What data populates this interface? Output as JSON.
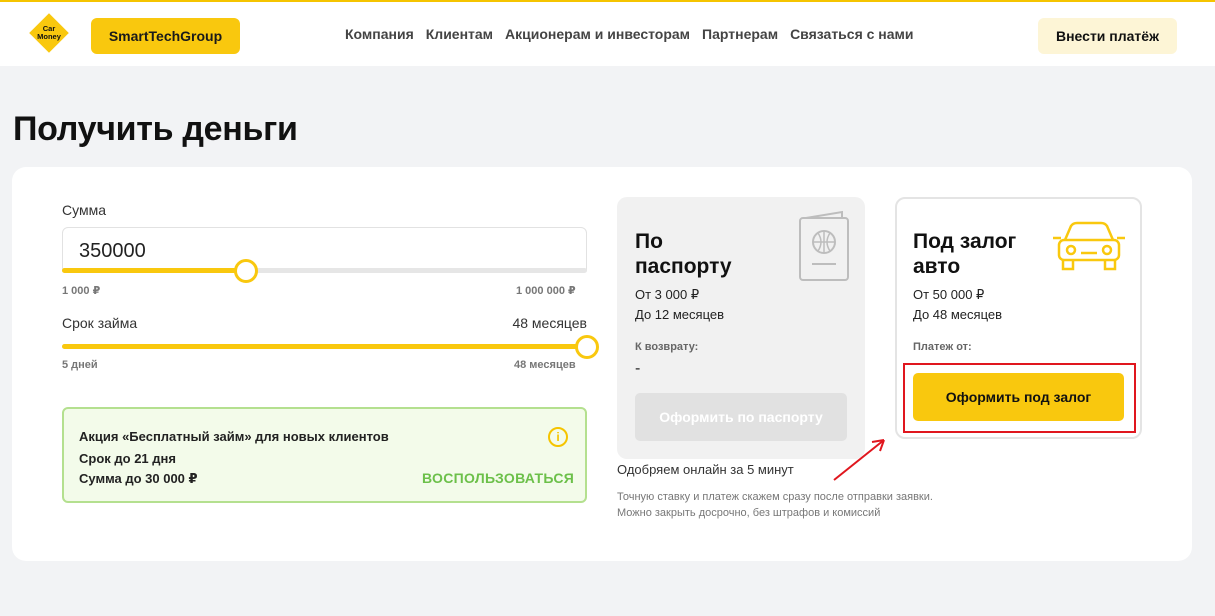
{
  "header": {
    "logo_text_1": "Car",
    "logo_text_2": "Money",
    "brand_button": "SmartTechGroup",
    "nav": [
      "Компания",
      "Клиентам",
      "Акционерам и инвесторам",
      "Партнерам",
      "Связаться с нами"
    ],
    "pay_button": "Внести платёж"
  },
  "page_title": "Получить деньги",
  "form": {
    "amount_label": "Сумма",
    "amount_value": "350000",
    "amount_min": "1 000 ₽",
    "amount_max": "1 000 000 ₽",
    "amount_fraction": 0.35,
    "term_label": "Срок займа",
    "term_value": "48 месяцев",
    "term_min": "5 дней",
    "term_max": "48 месяцев",
    "term_fraction": 1.0
  },
  "promo": {
    "title": "Акция «Бесплатный займ» для новых клиентов",
    "line1": "Срок до 21 дня",
    "line2": "Сумма до 30 000 ₽",
    "action": "ВОСПОЛЬЗОВАТЬСЯ",
    "info_icon": "i"
  },
  "passport_option": {
    "title_1": "По",
    "title_2": "паспорту",
    "from": "От 3 000 ₽",
    "to": "До 12 месяцев",
    "return_label": "К возврату:",
    "return_value": "-",
    "button": "Оформить по паспорту",
    "icon": "passport-icon"
  },
  "car_option": {
    "title_1": "Под залог",
    "title_2": "авто",
    "from": "От 50 000 ₽",
    "to": "До 48 месяцев",
    "payment_label": "Платеж от:",
    "button": "Оформить под залог",
    "icon": "car-icon"
  },
  "approve_text": "Одобряем онлайн за 5 минут",
  "note_1": "Точную ставку и платеж скажем сразу после отправки заявки.",
  "note_2": "Можно закрыть досрочно, без штрафов и комиссий",
  "colors": {
    "accent": "#f9c80e",
    "promo_green": "#6cc04a",
    "highlight": "#e0161e"
  }
}
